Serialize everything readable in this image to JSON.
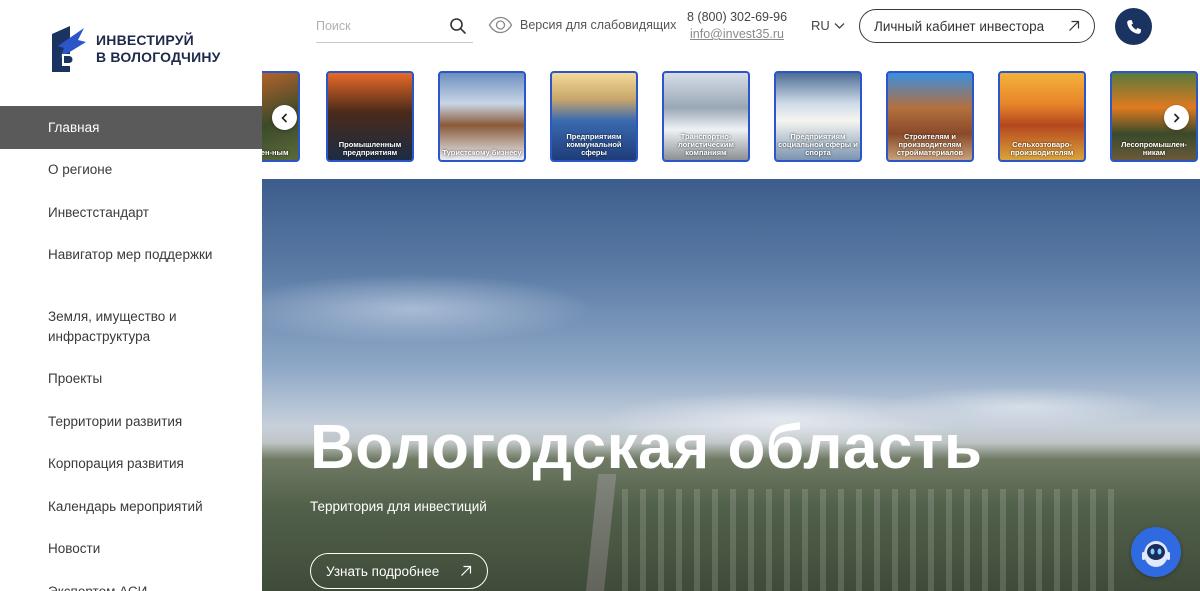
{
  "brand": {
    "line1": "ИНВЕСТИРУЙ",
    "line2": "В ВОЛОГОДЧИНУ"
  },
  "header": {
    "search_placeholder": "Поиск",
    "accessibility_label": "Версия для слабовидящих",
    "phone": "8 (800) 302-69-96",
    "email": "info@invest35.ru",
    "language": "RU",
    "cabinet_label": "Личный кабинет инвестора"
  },
  "sidebar": {
    "items": [
      {
        "label": "Главная",
        "active": true
      },
      {
        "label": "О регионе"
      },
      {
        "label": "Инвестстандарт"
      },
      {
        "label": "Навигатор мер поддержки"
      },
      {
        "label": "Земля, имущество и инфраструктура"
      },
      {
        "label": "Проекты"
      },
      {
        "label": "Территории развития"
      },
      {
        "label": "Корпорация развития"
      },
      {
        "label": "Календарь мероприятий"
      },
      {
        "label": "Новости"
      },
      {
        "label": "Экспортом АСИ"
      }
    ]
  },
  "carousel": {
    "cards": [
      {
        "label": "Промышлен-ным"
      },
      {
        "label": "Промышленным предприятиям"
      },
      {
        "label": "Туристскому бизнесу"
      },
      {
        "label": "Предприятиям коммунальной сферы"
      },
      {
        "label": "Транспортно-логистическим компаниям"
      },
      {
        "label": "Предприятиям социальной сферы и спорта"
      },
      {
        "label": "Строителям и производителям стройматериалов"
      },
      {
        "label": "Сельхозтоваро-производителям"
      },
      {
        "label": "Лесопромышлен-никам"
      }
    ]
  },
  "hero": {
    "title": "Вологодская область",
    "subtitle": "Территория для инвестиций",
    "button_label": "Узнать подробнее"
  },
  "colors": {
    "accent": "#1b3360",
    "card_border": "#2c55c9",
    "active_nav": "#5a5a5a"
  }
}
